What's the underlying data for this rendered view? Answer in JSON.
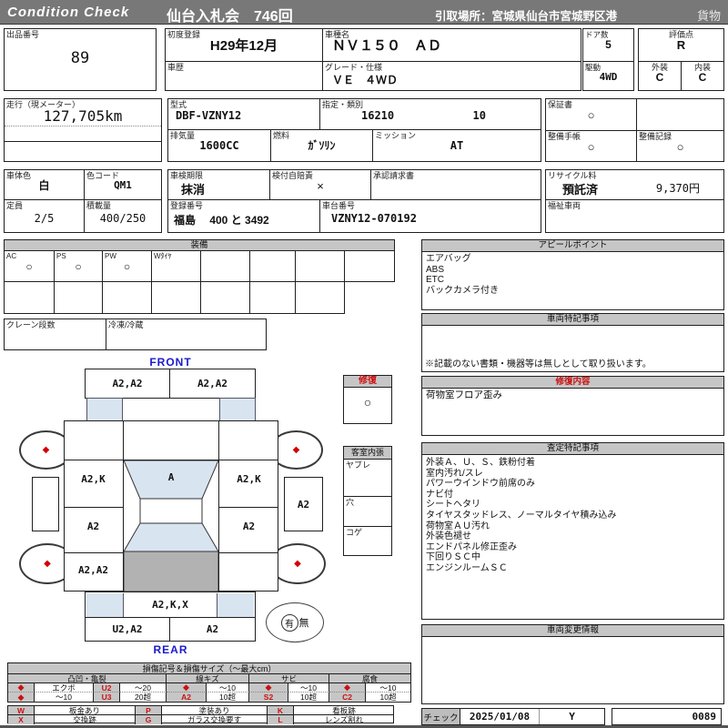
{
  "header": {
    "brand": "Condition  Check",
    "title": "仙台入札会　746回",
    "pickup": "引取場所：宮城県仙台市宮城野区港",
    "category": "貨物"
  },
  "info": {
    "lot_label": "出品番号",
    "lot_value": "89",
    "first_reg_label": "初度登録",
    "first_reg_value": "H29年12月",
    "history_label": "車歴",
    "history_value": "",
    "model_label": "車種名",
    "model_value": "ＮＶ１５０　ＡＤ",
    "grade_label": "グレード・仕様",
    "grade_value": "ＶＥ　４ＷＤ",
    "doors_label": "ドア数",
    "doors_value": "5",
    "drive_label": "駆動",
    "drive_value": "4WD",
    "score_label": "評価点",
    "score_value": "R",
    "exterior_label": "外装",
    "exterior_value": "C",
    "interior_label": "内装",
    "interior_value": "C",
    "mileage_label": "走行（現メーター）",
    "mileage_value": "127,705km",
    "model_code_label": "型式",
    "model_code_value": "DBF-VZNY12",
    "class_label": "指定・類別",
    "class_value1": "16210",
    "class_value2": "10",
    "displacement_label": "排気量",
    "displacement_value": "1600CC",
    "fuel_label": "燃料",
    "fuel_value": "ｶﾞｿﾘﾝ",
    "transmission_label": "ミッション",
    "transmission_value": "AT",
    "warranty_label": "保証書",
    "warranty_value": "○",
    "maintenance_book_label": "整備手帳",
    "maintenance_book_value": "○",
    "maintenance_record_label": "整備記録",
    "maintenance_record_value": "○",
    "color_label": "車体色",
    "color_value": "白",
    "color_code_label": "色コード",
    "color_code_value": "QM1",
    "capacity_label": "定員",
    "capacity_value": "2/5",
    "load_label": "積載量",
    "load_value": "400/250",
    "inspection_label": "車検期限",
    "inspection_value": "抹消",
    "insurance_label": "検付自賠責",
    "insurance_value": "×",
    "approval_label": "承認請求書",
    "approval_value": "",
    "plate_label": "登録番号",
    "plate_value": "福島　 400 と 3492",
    "chassis_label": "車台番号",
    "chassis_value": "VZNY12-070192",
    "recycle_label": "リサイクル料",
    "recycle_status": "預託済",
    "recycle_fee": "9,370円",
    "welfare_label": "福祉車両",
    "welfare_value": ""
  },
  "equipment": {
    "title": "装備",
    "row1": [
      {
        "label": "AC",
        "value": "○"
      },
      {
        "label": "PS",
        "value": "○"
      },
      {
        "label": "PW",
        "value": "○"
      },
      {
        "label": "Wﾀｲﾔ",
        "value": ""
      },
      {
        "label": "",
        "value": ""
      },
      {
        "label": "",
        "value": ""
      },
      {
        "label": "",
        "value": ""
      },
      {
        "label": "",
        "value": ""
      }
    ],
    "crane_label": "クレーン段数",
    "crane_value": "",
    "freezer_label": "冷凍/冷蔵",
    "freezer_value": ""
  },
  "diagram": {
    "front_label": "FRONT",
    "rear_label": "REAR",
    "front_bumper_left": "A2,A2",
    "front_bumper_right": "A2,A2",
    "left_front_door": "A2,K",
    "windshield": "A",
    "right_front_door": "A2,K",
    "right_side_panel": "A2",
    "left_rear_door": "A2",
    "right_rear_door": "A2",
    "left_quarter": "A2,A2",
    "rear_panel": "A2,K,X",
    "rear_bumper_left": "U2,A2",
    "rear_bumper_right": "A2",
    "wheel_mark": "◆",
    "presence_yes": "有",
    "presence_no": "無"
  },
  "repair_box": {
    "title": "修復",
    "value": "○"
  },
  "cabin_box": {
    "title": "客室内張",
    "rows": [
      "ヤブレ",
      "穴",
      "コゲ"
    ]
  },
  "panels": {
    "appeal": {
      "title": "アピールポイント",
      "lines": [
        "エアバッグ",
        "ABS",
        "ETC",
        "バックカメラ付き"
      ]
    },
    "vehicle_notes": {
      "title": "車両特記事項",
      "footnote": "※記載のない書類・機器等は無しとして取り扱います。"
    },
    "repair_details": {
      "title": "修復内容",
      "lines": [
        "荷物室フロア歪み"
      ]
    },
    "assessment": {
      "title": "査定特記事項",
      "lines": [
        "外装Ａ、Ｕ、Ｓ、鉄粉付着",
        "室内汚れ/スレ",
        "パワーウインドウ前席のみ",
        "ナビ付",
        "シートヘタリ",
        "タイヤスタッドレス、ノーマルタイヤ積み込み",
        "荷物室ＡＵ汚れ",
        "外装色褪せ",
        "エンドパネル修正歪み",
        "下回りＳＣ中",
        "エンジンルームＳＣ"
      ]
    },
    "change_info": {
      "title": "車両変更情報"
    }
  },
  "legend": {
    "title": "損傷記号＆損傷サイズ（～最大cm）",
    "groups": [
      "凸凹・亀裂",
      "線キズ",
      "サビ",
      "腐食"
    ],
    "row1": [
      "◆",
      "エクボ",
      "U2",
      "～20",
      "◆",
      "～10",
      "◆",
      "～10",
      "◆",
      "～10"
    ],
    "row2": [
      "◆",
      "～10",
      "U3",
      "20超",
      "A2",
      "10超",
      "S2",
      "10超",
      "C2",
      "10超"
    ],
    "codes_row1": [
      "W",
      "板金あり",
      "P",
      "塗装あり",
      "K",
      "看板跡"
    ],
    "codes_row2": [
      "X",
      "交換跡",
      "G",
      "ガラス交換要す",
      "L",
      "レンズ割れ"
    ]
  },
  "footer": {
    "check_label": "チェック",
    "date": "2025/01/08",
    "mark": "Y",
    "number": "0089"
  },
  "colors": {
    "accent_red": "#cc1111",
    "blue": "#1a1acc",
    "light_blue": "#d9e4f1",
    "gray_fill": "#c6c6c6",
    "top_bar": "#787878",
    "cargo_gray": "#b2b2b2"
  }
}
